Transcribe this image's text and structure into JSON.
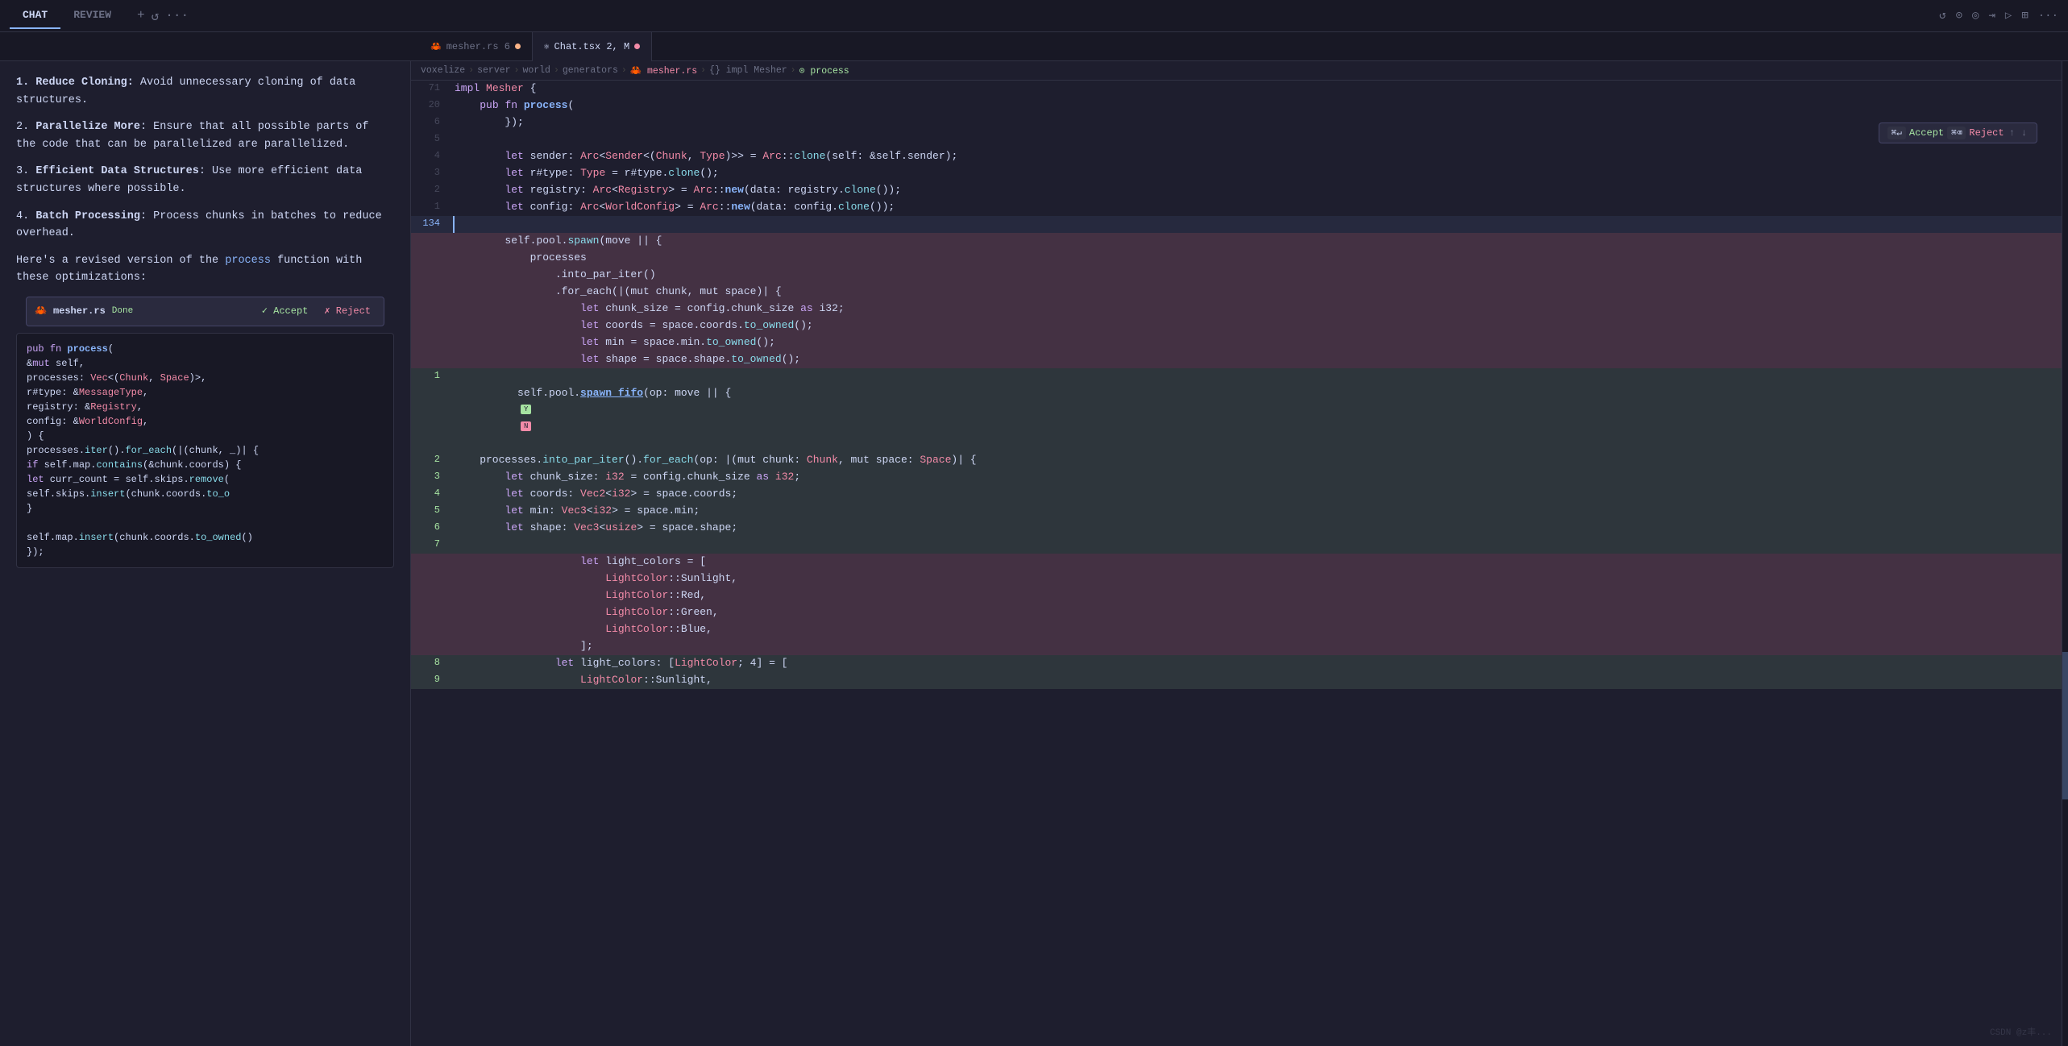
{
  "titleBar": {
    "tabs": [
      {
        "id": "chat",
        "label": "CHAT",
        "active": true
      },
      {
        "id": "review",
        "label": "REVIEW",
        "active": false
      }
    ],
    "actions": [
      "+",
      "↺",
      "···"
    ],
    "rightIcons": [
      "↺",
      "⊙",
      "◎",
      "⇥",
      "▷",
      "⊞",
      "···"
    ]
  },
  "editorTabs": [
    {
      "name": "mesher.rs",
      "badge": "6",
      "dot": "orange",
      "icon": "🦀",
      "active": false
    },
    {
      "name": "Chat.tsx",
      "badge": "2, M",
      "dot": "orange",
      "icon": "⚛",
      "active": true
    }
  ],
  "breadcrumb": {
    "parts": [
      "voxelize",
      "server",
      "world",
      "generators",
      "mesher.rs",
      "{} impl Mesher",
      "process"
    ]
  },
  "floatBar": {
    "acceptLabel": "Accept",
    "rejectLabel": "Reject",
    "acceptKbd": "⌘↵",
    "rejectKbd": "⌘⌫"
  },
  "chatContent": {
    "intro": "1. Reduce Cloning: Avoid unnecessary cloning of data structures.",
    "item2title": "Parallelize More",
    "item2text": ": Ensure that all possible parts of the code that can be parallelized are parallelized.",
    "item3title": "Efficient Data Structures",
    "item3text": ": Use more efficient data structures where possible.",
    "item4title": "Batch Processing",
    "item4text": ": Process chunks in batches to reduce overhead.",
    "revisionIntro": "Here's a revised version of the ",
    "revisionLink": "process",
    "revisionSuffix": " function with these optimizations:",
    "diffBar": {
      "fileName": "mesher.rs",
      "status": "Done",
      "acceptLabel": "✓ Accept",
      "rejectLabel": "✗ Reject"
    }
  },
  "codeBlock": {
    "lines": [
      "pub fn process(",
      "    &mut self,",
      "    processes: Vec<(Chunk, Space)>,",
      "    r#type: &MessageType,",
      "    registry: &Registry,",
      "    config: &WorldConfig,",
      ") {",
      "    processes.iter().for_each(|(chunk, _)| {",
      "        if self.map.contains(&chunk.coords) {",
      "            let curr_count = self.skips.remove(",
      "            self.skips.insert(chunk.coords.to_o",
      "        }",
      "",
      "        self.map.insert(chunk.coords.to_owned()",
      "    });",
      ""
    ]
  },
  "editorLines": [
    {
      "num": "71",
      "content": "impl Mesher {",
      "type": "normal"
    },
    {
      "num": "20",
      "content": "    pub fn process(",
      "type": "normal"
    },
    {
      "num": "6",
      "content": "        });",
      "type": "normal"
    },
    {
      "num": "5",
      "content": "",
      "type": "normal"
    },
    {
      "num": "4",
      "content": "        let sender: Arc<Sender<(Chunk, Type)>> = Arc::clone(self: &self.sender);",
      "type": "normal"
    },
    {
      "num": "3",
      "content": "        let r#type: Type = r#type.clone();",
      "type": "normal"
    },
    {
      "num": "2",
      "content": "        let registry: Arc<Registry> = Arc::new(data: registry.clone());",
      "type": "normal"
    },
    {
      "num": "1",
      "content": "        let config: Arc<WorldConfig> = Arc::new(data: config.clone());",
      "type": "normal"
    },
    {
      "num": "134",
      "content": "",
      "type": "cursor"
    },
    {
      "num": "",
      "content": "        self.pool.spawn(move || {",
      "type": "deleted"
    },
    {
      "num": "",
      "content": "            processes",
      "type": "deleted"
    },
    {
      "num": "",
      "content": "                .into_par_iter()",
      "type": "deleted"
    },
    {
      "num": "",
      "content": "                .for_each(|(mut chunk, mut space)| {",
      "type": "deleted"
    },
    {
      "num": "",
      "content": "                    let chunk_size = config.chunk_size as i32;",
      "type": "deleted"
    },
    {
      "num": "",
      "content": "                    let coords = space.coords.to_owned();",
      "type": "deleted"
    },
    {
      "num": "",
      "content": "                    let min = space.min.to_owned();",
      "type": "deleted"
    },
    {
      "num": "",
      "content": "                    let shape = space.shape.to_owned();",
      "type": "deleted"
    },
    {
      "num": "1",
      "content": "        self.pool.spawn_fifo(op: move || {",
      "type": "added"
    },
    {
      "num": "2",
      "content": "            processes.into_par_iter().for_each(op: |(mut chunk: Chunk, mut space: Space)| {",
      "type": "added"
    },
    {
      "num": "3",
      "content": "                let chunk_size: i32 = config.chunk_size as i32;",
      "type": "added"
    },
    {
      "num": "4",
      "content": "                let coords: Vec2<i32> = space.coords;",
      "type": "added"
    },
    {
      "num": "5",
      "content": "                let min: Vec3<i32> = space.min;",
      "type": "added"
    },
    {
      "num": "6",
      "content": "                let shape: Vec3<usize> = space.shape;",
      "type": "added"
    },
    {
      "num": "7",
      "content": "",
      "type": "added"
    },
    {
      "num": "",
      "content": "                    let light_colors = [",
      "type": "deleted"
    },
    {
      "num": "",
      "content": "                        LightColor::Sunlight,",
      "type": "deleted"
    },
    {
      "num": "",
      "content": "                        LightColor::Red,",
      "type": "deleted"
    },
    {
      "num": "",
      "content": "                        LightColor::Green,",
      "type": "deleted"
    },
    {
      "num": "",
      "content": "                        LightColor::Blue,",
      "type": "deleted"
    },
    {
      "num": "",
      "content": "                    ];",
      "type": "deleted"
    },
    {
      "num": "8",
      "content": "                let light_colors: [LightColor; 4] = [",
      "type": "added"
    },
    {
      "num": "9",
      "content": "                    LightColor::Sunlight,",
      "type": "added"
    }
  ],
  "watermark": "CSDN @z丰..."
}
